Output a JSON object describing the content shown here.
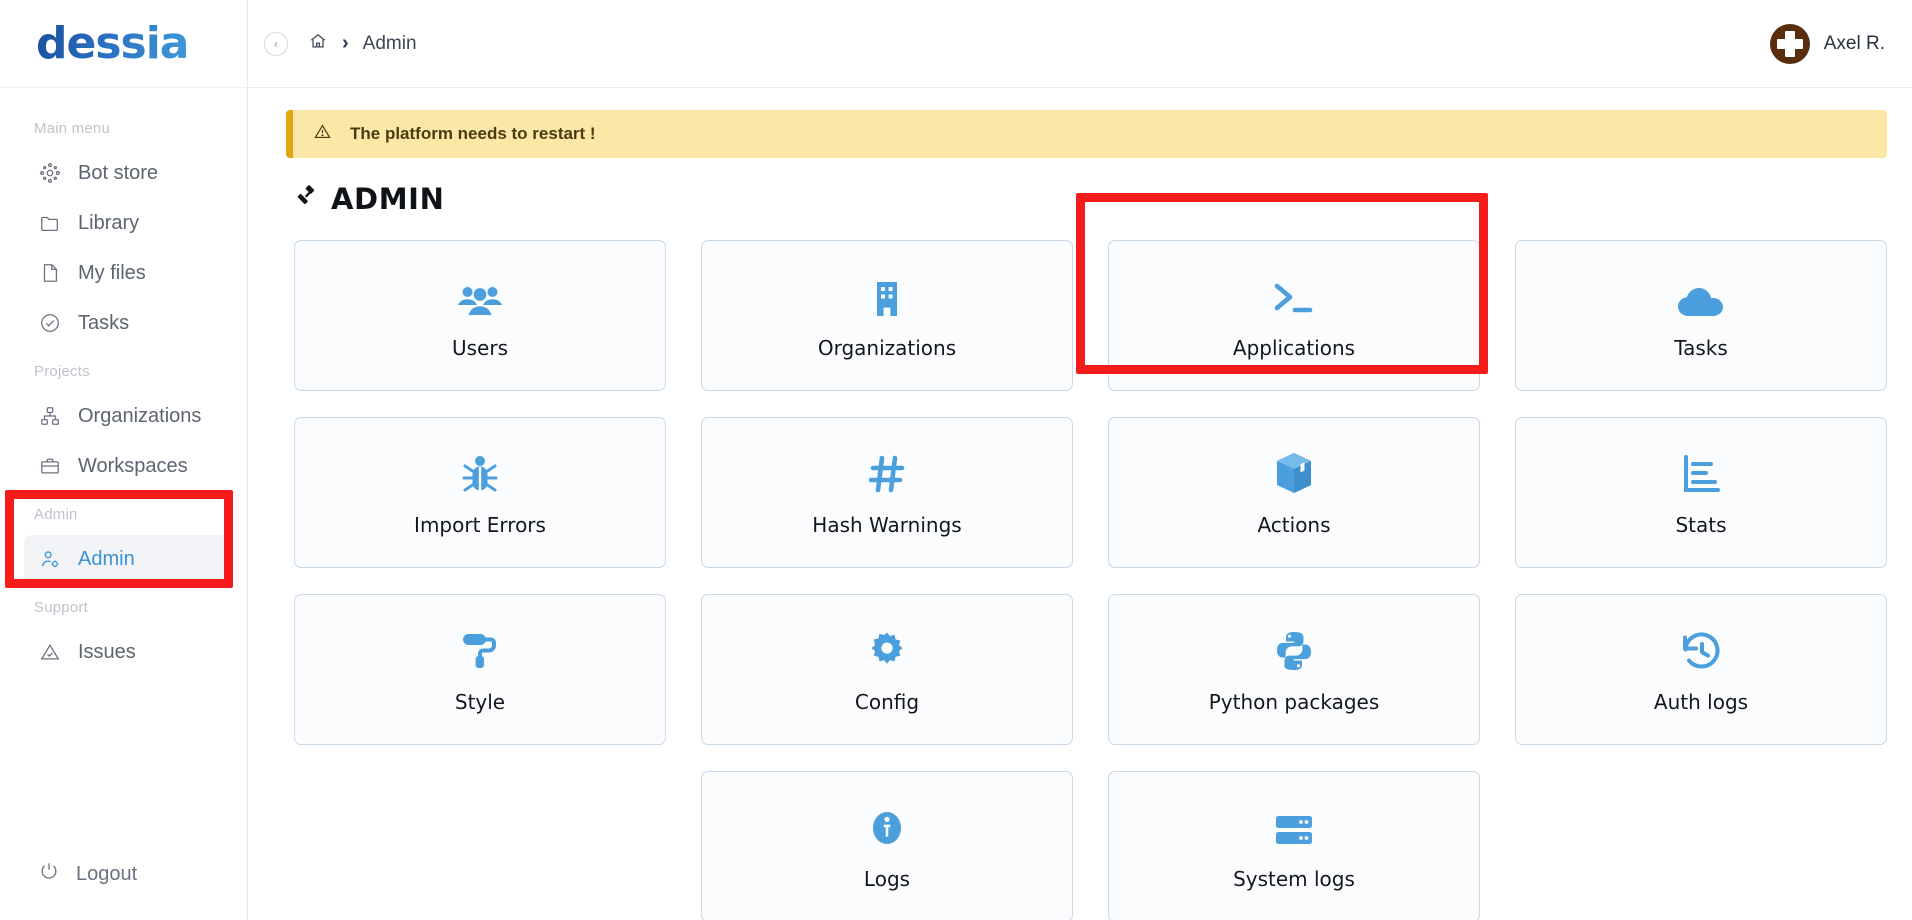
{
  "brand": {
    "logo_text": "dessia"
  },
  "sidebar": {
    "sections": [
      {
        "label": "Main menu",
        "items": [
          {
            "label": "Bot store",
            "icon": "bot-store-icon",
            "active": false
          },
          {
            "label": "Library",
            "icon": "folder-icon",
            "active": false
          },
          {
            "label": "My files",
            "icon": "file-icon",
            "active": false
          },
          {
            "label": "Tasks",
            "icon": "check-circle-icon",
            "active": false
          }
        ]
      },
      {
        "label": "Projects",
        "items": [
          {
            "label": "Organizations",
            "icon": "sitemap-icon",
            "active": false
          },
          {
            "label": "Workspaces",
            "icon": "briefcase-icon",
            "active": false
          }
        ]
      },
      {
        "label": "Admin",
        "items": [
          {
            "label": "Admin",
            "icon": "user-gear-icon",
            "active": true
          }
        ]
      },
      {
        "label": "Support",
        "items": [
          {
            "label": "Issues",
            "icon": "warning-triangle-icon",
            "active": false
          }
        ]
      }
    ],
    "logout": {
      "label": "Logout",
      "icon": "power-icon"
    }
  },
  "topbar": {
    "collapse_label": "‹",
    "breadcrumb": {
      "home_icon": "home-icon",
      "separator": "›",
      "current": "Admin"
    },
    "user": {
      "name": "Axel R.",
      "avatar_icon": "medical-cross-avatar"
    }
  },
  "alert": {
    "icon": "warning-triangle-icon",
    "text": "The platform needs to restart !"
  },
  "page": {
    "icon": "gavel-icon",
    "title": "ADMIN"
  },
  "cards": [
    {
      "label": "Users",
      "icon": "users-icon"
    },
    {
      "label": "Organizations",
      "icon": "building-icon"
    },
    {
      "label": "Applications",
      "icon": "terminal-prompt-icon"
    },
    {
      "label": "Tasks",
      "icon": "cloud-icon"
    },
    {
      "label": "Import Errors",
      "icon": "bug-icon"
    },
    {
      "label": "Hash Warnings",
      "icon": "hash-icon"
    },
    {
      "label": "Actions",
      "icon": "cube-icon"
    },
    {
      "label": "Stats",
      "icon": "bar-chart-icon"
    },
    {
      "label": "Style",
      "icon": "paint-roller-icon"
    },
    {
      "label": "Config",
      "icon": "gear-icon"
    },
    {
      "label": "Python packages",
      "icon": "python-icon"
    },
    {
      "label": "Auth logs",
      "icon": "history-clock-icon"
    },
    {
      "label": "Logs",
      "icon": "info-circle-icon"
    },
    {
      "label": "System logs",
      "icon": "server-stack-icon"
    }
  ],
  "annotations": {
    "applications_highlight": {
      "target": "Applications",
      "color": "#f71c1c"
    },
    "admin_menu_highlight": {
      "target": "Admin",
      "color": "#f71c1c"
    }
  }
}
